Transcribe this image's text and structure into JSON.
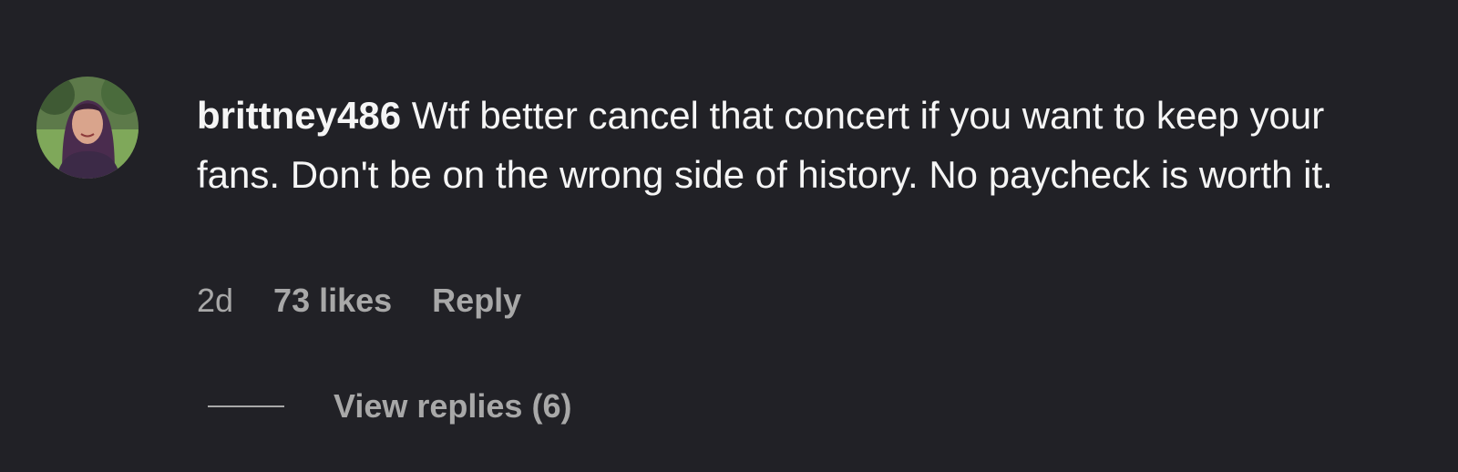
{
  "comment": {
    "username": "brittney486",
    "text": "Wtf better cancel that concert if you want to keep your fans. Don't be on the wrong side of history. No paycheck is worth it.",
    "time": "2d",
    "likes": "73 likes",
    "reply_label": "Reply",
    "view_replies_label": "View replies (6)"
  },
  "colors": {
    "background": "#212126",
    "text_primary": "#f5f5f5",
    "text_secondary": "#a8a8a8"
  },
  "icons": {
    "avatar": "user-profile-photo"
  }
}
